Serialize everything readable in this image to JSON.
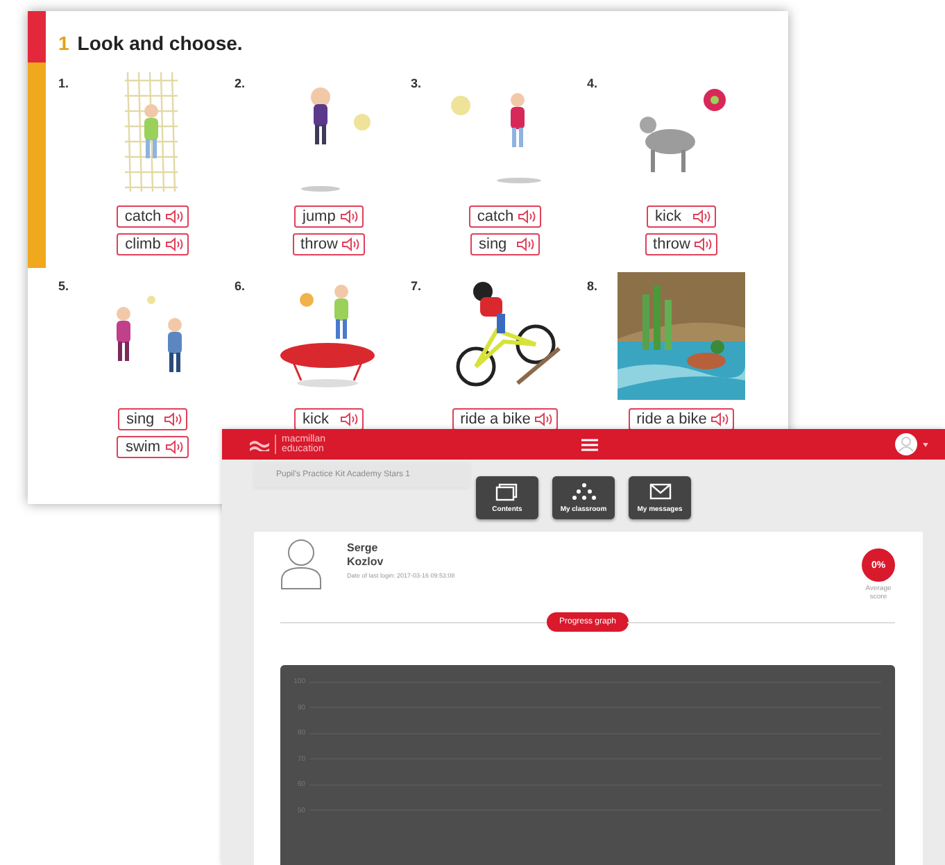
{
  "worksheet": {
    "exercise_number": "1",
    "title": "Look and choose.",
    "items": [
      {
        "number": "1.",
        "options": [
          "catch",
          "climb"
        ]
      },
      {
        "number": "2.",
        "options": [
          "jump",
          "throw"
        ]
      },
      {
        "number": "3.",
        "options": [
          "catch",
          "sing"
        ]
      },
      {
        "number": "4.",
        "options": [
          "kick",
          "throw"
        ]
      },
      {
        "number": "5.",
        "options": [
          "sing",
          "swim"
        ]
      },
      {
        "number": "6.",
        "options": [
          "kick"
        ]
      },
      {
        "number": "7.",
        "options": [
          "ride a bike"
        ]
      },
      {
        "number": "8.",
        "options": [
          "ride a bike"
        ]
      }
    ]
  },
  "app": {
    "logo": {
      "line_1": "macmillan",
      "line_2": "education"
    },
    "breadcrumb": "Pupil's Practice Kit Academy Stars 1",
    "nav": [
      {
        "kind": "contents",
        "label": "Contents"
      },
      {
        "kind": "classroom",
        "label": "My classroom"
      },
      {
        "kind": "messages",
        "label": "My messages"
      }
    ],
    "profile": {
      "first_name": "Serge",
      "last_name": "Kozlov",
      "last_login": "Date of last login: 2017-03-16 09:53:08",
      "score": "0%",
      "score_label": "Average score"
    },
    "section_button": "Progress graph",
    "chart": {
      "y_labels": [
        "100",
        "90",
        "80",
        "70",
        "60",
        "50"
      ]
    }
  }
}
